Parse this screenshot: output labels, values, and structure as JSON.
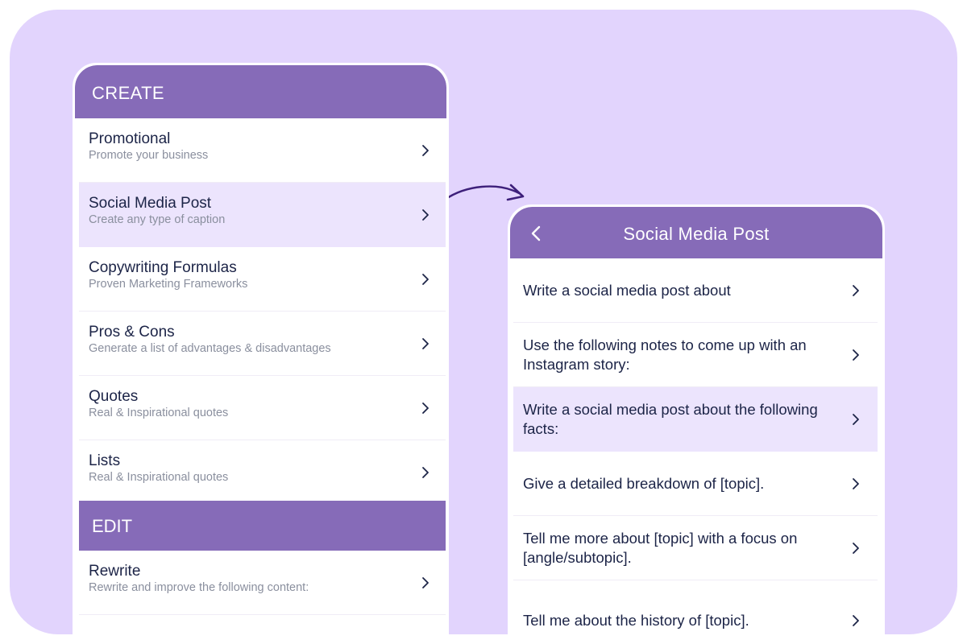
{
  "create_panel": {
    "section_title": "CREATE",
    "items": [
      {
        "title": "Promotional",
        "subtitle": "Promote your business"
      },
      {
        "title": "Social Media Post",
        "subtitle": "Create any type of caption"
      },
      {
        "title": "Copywriting Formulas",
        "subtitle": "Proven Marketing Frameworks"
      },
      {
        "title": "Pros & Cons",
        "subtitle": "Generate a list of advantages & disadvantages"
      },
      {
        "title": "Quotes",
        "subtitle": "Real & Inspirational quotes"
      },
      {
        "title": "Lists",
        "subtitle": "Real & Inspirational quotes"
      }
    ],
    "highlighted_item": "Social Media Post",
    "edit_section_title": "EDIT",
    "edit_items": [
      {
        "title": "Rewrite",
        "subtitle": "Rewrite and improve the following content:"
      }
    ]
  },
  "detail_panel": {
    "back_icon": "chevron-left-icon",
    "title": "Social Media Post",
    "prompts": [
      "Write a social media post about",
      "Use the following notes to come up with an Instagram story:",
      "Write a social media post about the following facts:",
      "Give a detailed breakdown of [topic].",
      "Tell me more about [topic] with a focus on [angle/subtopic].",
      "Tell me about the history of [topic]."
    ],
    "highlighted_prompt": "Write a social media post about the following facts:"
  },
  "colors": {
    "backdrop": "#e2d4fd",
    "header": "#866bb8",
    "highlight": "#ece4fd",
    "text": "#1c2447",
    "subtext": "#8a8f9e"
  }
}
